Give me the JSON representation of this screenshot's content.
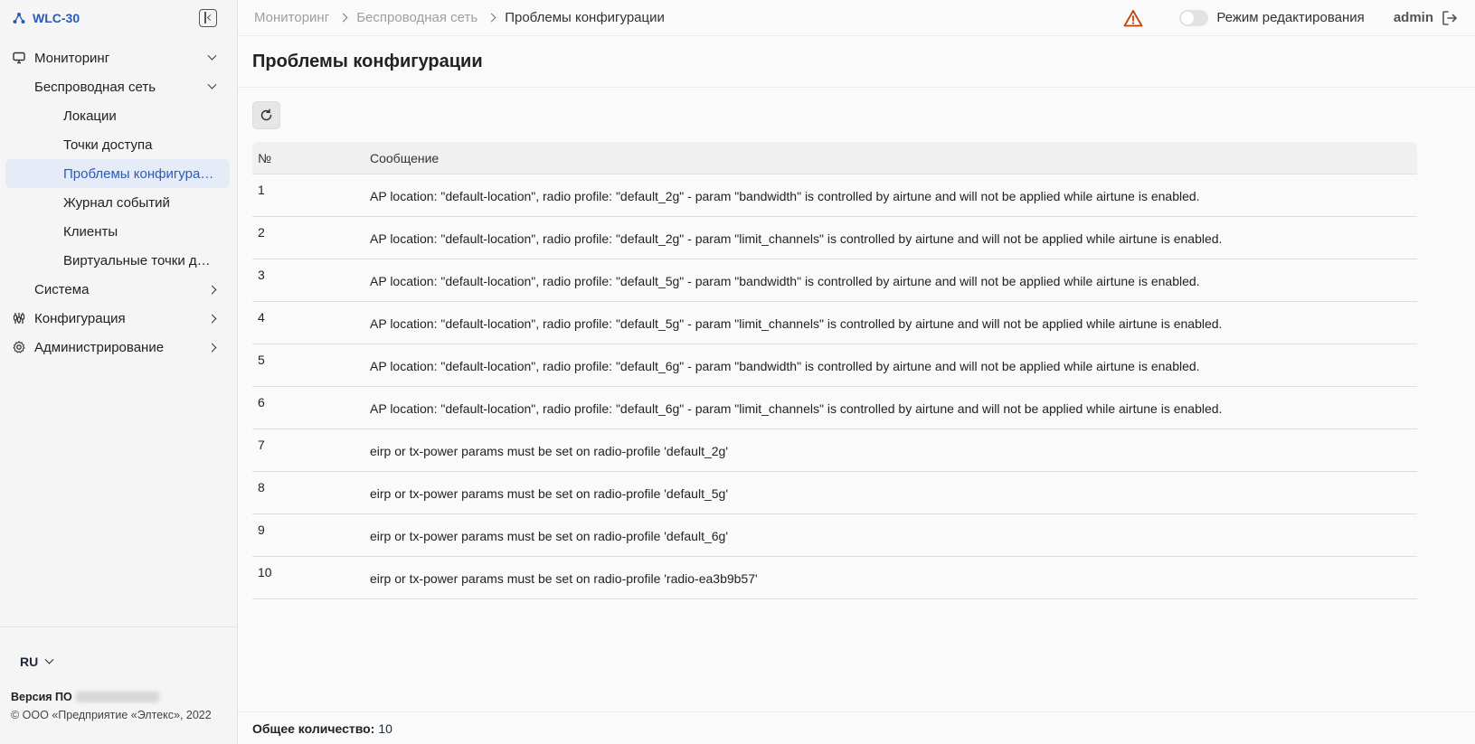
{
  "app": {
    "name": "WLC-30"
  },
  "sidebar": {
    "items": [
      {
        "label": "Мониторинг"
      },
      {
        "label": "Беспроводная сеть"
      },
      {
        "label": "Локации"
      },
      {
        "label": "Точки доступа"
      },
      {
        "label": "Проблемы конфигурации"
      },
      {
        "label": "Журнал событий"
      },
      {
        "label": "Клиенты"
      },
      {
        "label": "Виртуальные точки дост..."
      },
      {
        "label": "Система"
      },
      {
        "label": "Конфигурация"
      },
      {
        "label": "Администрирование"
      }
    ],
    "language": "RU",
    "version_label": "Версия ПО",
    "copyright": "© ООО «Предприятие «Элтекс», 2022"
  },
  "topbar": {
    "breadcrumb": [
      "Мониторинг",
      "Беспроводная сеть",
      "Проблемы конфигурации"
    ],
    "edit_mode_label": "Режим редактирования",
    "edit_mode_on": false,
    "user": "admin"
  },
  "page": {
    "title": "Проблемы конфигурации"
  },
  "table": {
    "columns": [
      "№",
      "Сообщение"
    ],
    "rows": [
      {
        "num": "1",
        "message": "AP location: \"default-location\", radio profile: \"default_2g\" - param \"bandwidth\" is controlled by airtune and will not be applied while airtune is enabled."
      },
      {
        "num": "2",
        "message": "AP location: \"default-location\", radio profile: \"default_2g\" - param \"limit_channels\" is controlled by airtune and will not be applied while airtune is enabled."
      },
      {
        "num": "3",
        "message": "AP location: \"default-location\", radio profile: \"default_5g\" - param \"bandwidth\" is controlled by airtune and will not be applied while airtune is enabled."
      },
      {
        "num": "4",
        "message": "AP location: \"default-location\", radio profile: \"default_5g\" - param \"limit_channels\" is controlled by airtune and will not be applied while airtune is enabled."
      },
      {
        "num": "5",
        "message": "AP location: \"default-location\", radio profile: \"default_6g\" - param \"bandwidth\" is controlled by airtune and will not be applied while airtune is enabled."
      },
      {
        "num": "6",
        "message": "AP location: \"default-location\", radio profile: \"default_6g\" - param \"limit_channels\" is controlled by airtune and will not be applied while airtune is enabled."
      },
      {
        "num": "7",
        "message": "eirp or tx-power params must be set on radio-profile 'default_2g'"
      },
      {
        "num": "8",
        "message": "eirp or tx-power params must be set on radio-profile 'default_5g'"
      },
      {
        "num": "9",
        "message": "eirp or tx-power params must be set on radio-profile 'default_6g'"
      },
      {
        "num": "10",
        "message": "eirp or tx-power params must be set on radio-profile 'radio-ea3b9b57'"
      }
    ]
  },
  "footer": {
    "total_label": "Общее количество:",
    "total_value": "10"
  },
  "colors": {
    "accent": "#2a5bb8",
    "active_bg": "#e6ecf7",
    "warning": "#c2410c"
  }
}
